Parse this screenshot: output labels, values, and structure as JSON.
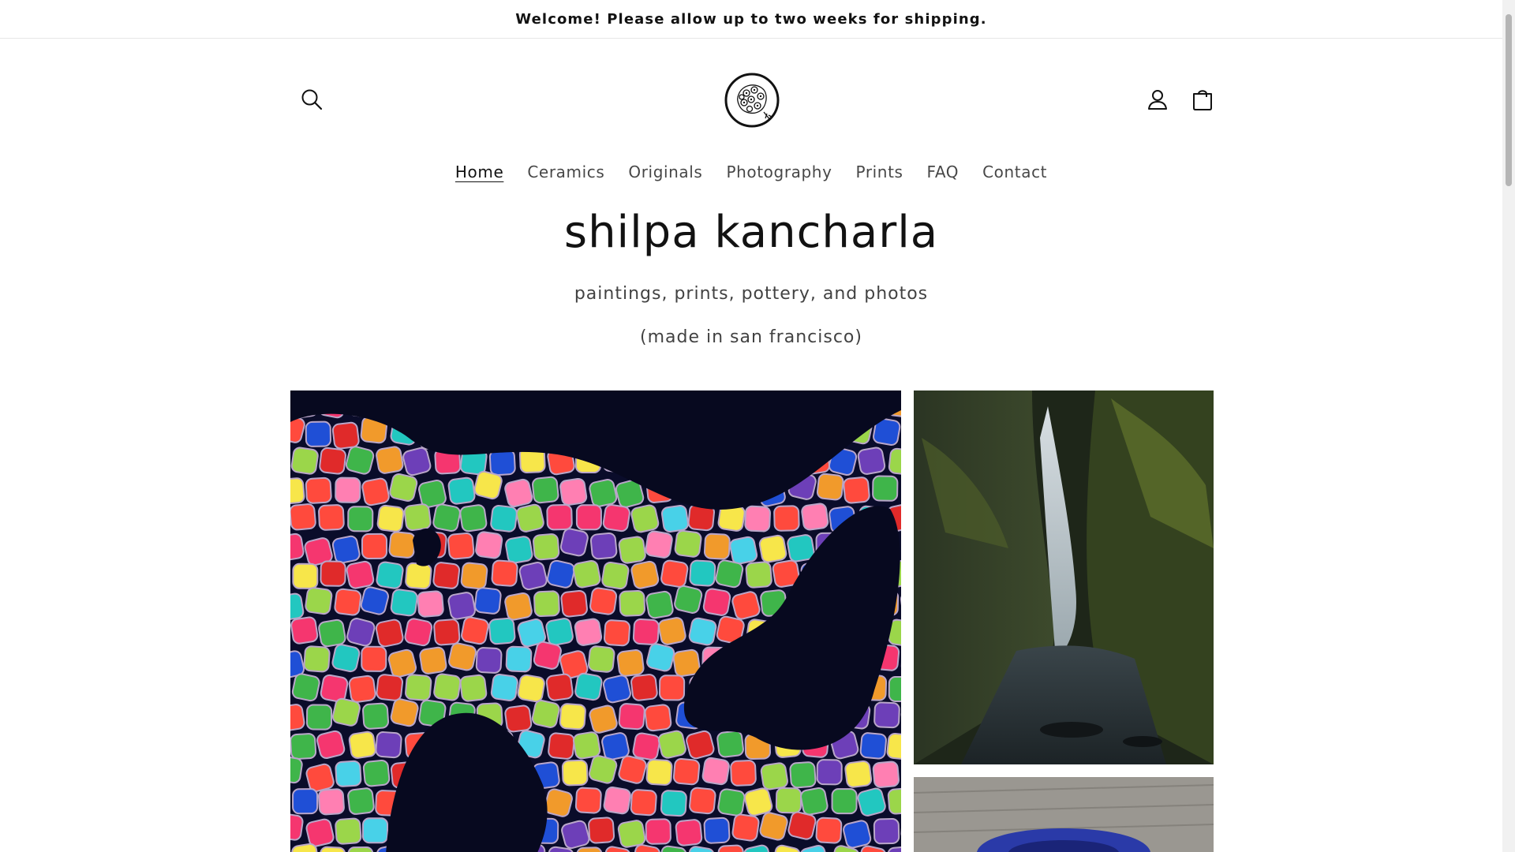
{
  "announcement": {
    "text": "Welcome! Please allow up to two weeks for shipping."
  },
  "header": {
    "icons": {
      "search": "search-icon",
      "account": "account-icon",
      "cart": "cart-icon"
    }
  },
  "nav": {
    "items": [
      {
        "label": "Home",
        "active": true
      },
      {
        "label": "Ceramics",
        "active": false
      },
      {
        "label": "Originals",
        "active": false
      },
      {
        "label": "Photography",
        "active": false
      },
      {
        "label": "Prints",
        "active": false
      },
      {
        "label": "FAQ",
        "active": false
      },
      {
        "label": "Contact",
        "active": false
      }
    ]
  },
  "hero": {
    "title": "shilpa kancharla",
    "subtitle": "paintings, prints, pottery, and photos",
    "location": "(made in san francisco)"
  },
  "colors": {
    "text": "#121212",
    "border": "#e6e6e6",
    "background": "#ffffff"
  }
}
